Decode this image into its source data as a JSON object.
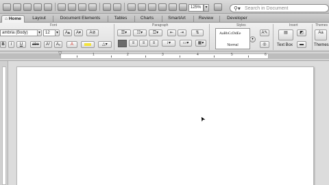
{
  "toolbar": {
    "zoom": "125%",
    "zoom_arrow": "▾",
    "search_placeholder": "Search in Document",
    "search_icon": "magnifier-icon"
  },
  "tabs": [
    {
      "label": "Home",
      "active": true
    },
    {
      "label": "Layout"
    },
    {
      "label": "Document Elements"
    },
    {
      "label": "Tables"
    },
    {
      "label": "Charts"
    },
    {
      "label": "SmartArt"
    },
    {
      "label": "Review"
    },
    {
      "label": "Developer"
    }
  ],
  "groups": {
    "font": "Font",
    "paragraph": "Paragraph",
    "styles": "Styles",
    "insert": "Insert",
    "themes": "Themes"
  },
  "font": {
    "name": "ambria (Body)",
    "size": "12",
    "grow": "A▴",
    "shrink": "A▾",
    "clear": "A⊘",
    "bold": "B",
    "italic": "I",
    "underline": "U",
    "strike": "abe",
    "superscript": "A²",
    "subscript": "A₂",
    "color_a": "A",
    "text_color": "#d22a1e",
    "highlight_color": "#f3e23a"
  },
  "styles": {
    "sample": "AaBbCcDdEe",
    "name": "Normal"
  },
  "insert": {
    "textbox_label": "Text Box"
  },
  "themes": {
    "label": "Themes"
  },
  "ruler": {
    "numbers": [
      "1",
      "2",
      "3",
      "4",
      "5",
      "6"
    ]
  }
}
